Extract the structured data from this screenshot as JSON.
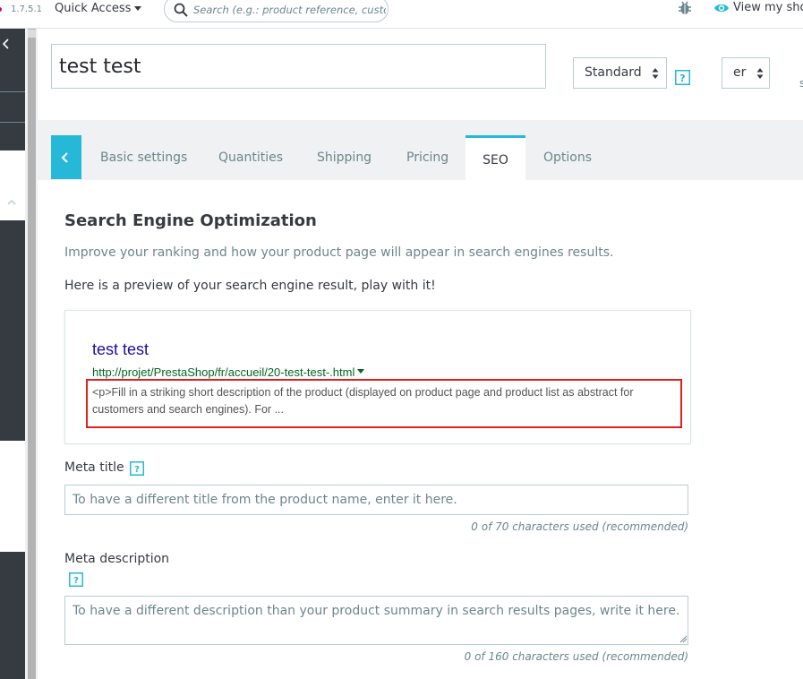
{
  "topbar": {
    "version": "1.7.5.1",
    "quick_access_label": "Quick Access",
    "search_placeholder": "Search (e.g.: product reference, custome",
    "view_shop_label": "View my sho"
  },
  "product": {
    "name": "test test",
    "type_select_value": "Standard",
    "lang_select_value": "er",
    "right_fragment": "s"
  },
  "tabs": [
    {
      "label": "Basic settings"
    },
    {
      "label": "Quantities"
    },
    {
      "label": "Shipping"
    },
    {
      "label": "Pricing"
    },
    {
      "label": "SEO",
      "active": true
    },
    {
      "label": "Options"
    }
  ],
  "seo": {
    "title": "Search Engine Optimization",
    "description": "Improve your ranking and how your product page will appear in search engines results.",
    "preview_intro": "Here is a preview of your search engine result, play with it!",
    "preview": {
      "title": "test test",
      "url": "http://projet/PrestaShop/fr/accueil/20-test-test-.html",
      "description": "<p>Fill in a striking short description of the product (displayed on product page and product list as abstract for customers and search engines). For ..."
    },
    "meta_title": {
      "label": "Meta title",
      "placeholder": "To have a different title from the product name, enter it here.",
      "counter": "0 of 70 characters used (recommended)"
    },
    "meta_description": {
      "label": "Meta description",
      "placeholder": "To have a different description than your product summary in search results pages, write it here.",
      "counter": "0 of 160 characters used (recommended)"
    }
  },
  "colors": {
    "accent": "#25b9d7",
    "sidebar": "#363a41",
    "highlight_box": "#e02020",
    "google_title": "#1a0dab",
    "google_url": "#006621"
  },
  "icons": [
    "search-icon",
    "bug-icon",
    "eye-icon",
    "chevron-left-icon",
    "chevron-up-icon",
    "help-icon",
    "select-arrows-icon",
    "caret-down-icon"
  ]
}
